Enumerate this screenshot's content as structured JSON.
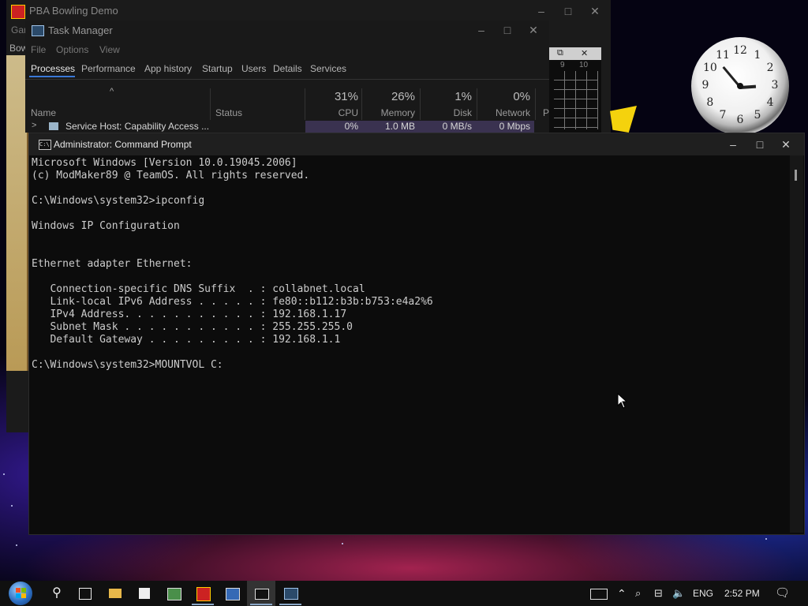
{
  "bowling_window": {
    "title": "PBA Bowling Demo",
    "menu_frag_1": "Gar",
    "menu_frag_2": "Bow",
    "scorecard_nums": [
      "9",
      "10"
    ]
  },
  "task_manager": {
    "title": "Task Manager",
    "menu": [
      "File",
      "Options",
      "View"
    ],
    "tabs": [
      "Processes",
      "Performance",
      "App history",
      "Startup",
      "Users",
      "Details",
      "Services"
    ],
    "active_tab": "Processes",
    "columns": {
      "name": "Name",
      "status": "Status",
      "cpu": {
        "pct": "31%",
        "label": "CPU"
      },
      "memory": {
        "pct": "26%",
        "label": "Memory"
      },
      "disk": {
        "pct": "1%",
        "label": "Disk"
      },
      "network": {
        "pct": "0%",
        "label": "Network"
      },
      "power_frag": "P"
    },
    "row": {
      "name": "Service Host: Capability Access ...",
      "cpu": "0%",
      "memory": "1.0 MB",
      "disk": "0 MB/s",
      "network": "0 Mbps"
    }
  },
  "cmd_window": {
    "title": "Administrator: Command Prompt",
    "lines": [
      "Microsoft Windows [Version 10.0.19045.2006]",
      "(c) ModMaker89 @ TeamOS. All rights reserved.",
      "",
      "C:\\Windows\\system32>ipconfig",
      "",
      "Windows IP Configuration",
      "",
      "",
      "Ethernet adapter Ethernet:",
      "",
      "   Connection-specific DNS Suffix  . : collabnet.local",
      "   Link-local IPv6 Address . . . . . : fe80::b112:b3b:b753:e4a2%6",
      "   IPv4 Address. . . . . . . . . . . : 192.168.1.17",
      "   Subnet Mask . . . . . . . . . . . : 255.255.255.0",
      "   Default Gateway . . . . . . . . . : 192.168.1.1",
      "",
      "C:\\Windows\\system32>MOUNTVOL C:"
    ]
  },
  "clock": {
    "numerals": [
      "12",
      "1",
      "2",
      "3",
      "4",
      "5",
      "6",
      "7",
      "8",
      "9",
      "10",
      "11"
    ],
    "time_shown": "2:52"
  },
  "taskbar": {
    "language": "ENG",
    "time": "2:52 PM",
    "icons": [
      "start-orb-icon",
      "search-icon",
      "task-view-icon",
      "file-explorer-icon",
      "store-icon",
      "app-icon",
      "bowling-app-icon",
      "network-app-icon",
      "cmd-app-icon",
      "task-manager-app-icon"
    ]
  },
  "colors": {
    "cmd_bg": "#0c0c0c",
    "cmd_text": "#cccccc",
    "taskbar_bg": "#101010",
    "tab_underline": "#3a78d6"
  }
}
